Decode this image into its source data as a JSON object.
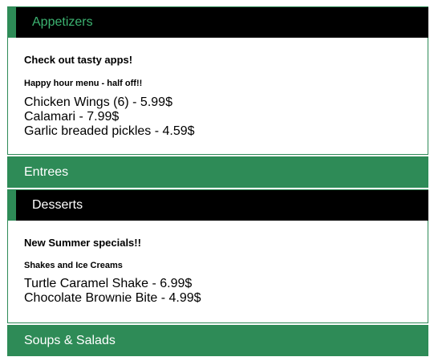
{
  "sections": [
    {
      "title": "Appetizers",
      "expanded": true,
      "heading": "Check out tasty apps!",
      "subheading": "Happy hour menu - half off!!",
      "items": [
        "Chicken Wings (6) - 5.99$",
        "Calamari - 7.99$",
        "Garlic breaded pickles - 4.59$"
      ]
    },
    {
      "title": "Entrees",
      "expanded": false
    },
    {
      "title": "Desserts",
      "expanded": true,
      "heading": "New Summer specials!!",
      "subheading": "Shakes and Ice Creams",
      "items": [
        "Turtle Caramel Shake - 6.99$",
        "Chocolate Brownie Bite - 4.99$"
      ]
    },
    {
      "title": "Soups & Salads",
      "expanded": false
    }
  ],
  "colors": {
    "accent": "#2e8b57",
    "active_header_bg": "#000000",
    "appetizers_title": "#3cb371"
  }
}
